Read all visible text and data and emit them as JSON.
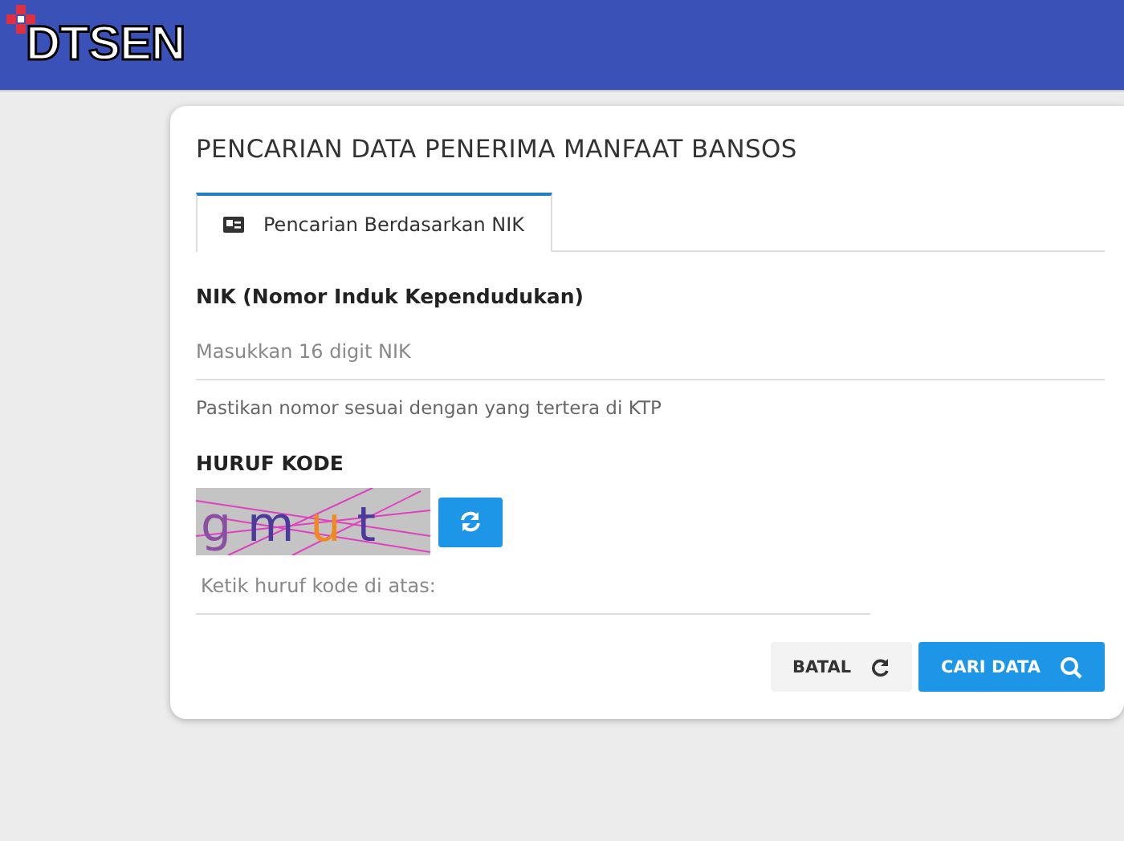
{
  "header": {
    "logo_text": "DTSEN"
  },
  "form": {
    "title": "PENCARIAN DATA PENERIMA MANFAAT BANSOS",
    "tabs": [
      {
        "label": "Pencarian Berdasarkan NIK",
        "selected": true
      }
    ],
    "nik_label": "NIK (Nomor Induk Kependudukan)",
    "nik_field": {
      "placeholder": "Masukkan 16 digit NIK"
    },
    "nik_hint": "Pastikan nomor sesuai dengan yang tertera di KTP",
    "captcha_label": "HURUF KODE",
    "captcha": {
      "letters": [
        {
          "char": "g",
          "color": "#8a4fa0"
        },
        {
          "char": "m",
          "color": "#4a3a9a"
        },
        {
          "char": "u",
          "color": "#f08a20"
        },
        {
          "char": "t",
          "color": "#4a3a9a"
        }
      ]
    },
    "captcha_field": {
      "placeholder": "Ketik huruf kode di atas:"
    },
    "buttons": [
      {
        "label": "BATAL",
        "kind": "reset"
      },
      {
        "label": "CARI DATA",
        "kind": "search"
      }
    ]
  }
}
